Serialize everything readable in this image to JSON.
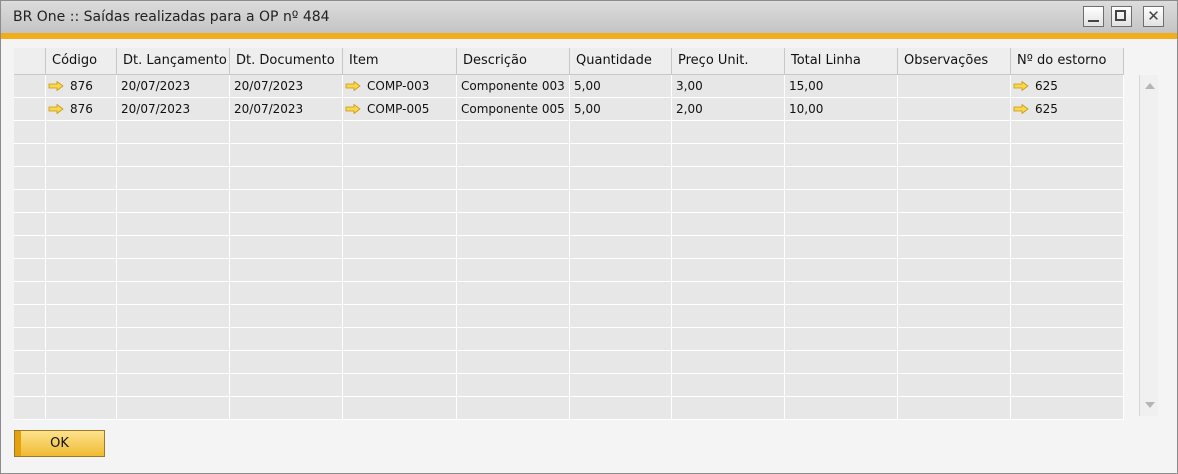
{
  "window": {
    "title": "BR One :: Saídas realizadas para a OP nº 484"
  },
  "table": {
    "columns": [
      "Código",
      "Dt. Lançamento",
      "Dt. Documento",
      "Item",
      "Descrição",
      "Quantidade",
      "Preço Unit.",
      "Total Linha",
      "Observações",
      "Nº do estorno"
    ],
    "rows": [
      {
        "codigo": "876",
        "dt_lancamento": "20/07/2023",
        "dt_documento": "20/07/2023",
        "item": "COMP-003",
        "descricao": "Componente 003",
        "quantidade": "5,00",
        "preco_unit": "3,00",
        "total_linha": "15,00",
        "observacoes": "",
        "estorno": "625"
      },
      {
        "codigo": "876",
        "dt_lancamento": "20/07/2023",
        "dt_documento": "20/07/2023",
        "item": "COMP-005",
        "descricao": "Componente 005",
        "quantidade": "5,00",
        "preco_unit": "2,00",
        "total_linha": "10,00",
        "observacoes": "",
        "estorno": "625"
      }
    ]
  },
  "buttons": {
    "ok": "OK"
  },
  "icons": {
    "link_arrow": "yellow-link-arrow-icon",
    "accent_color": "#f1ad1a"
  }
}
